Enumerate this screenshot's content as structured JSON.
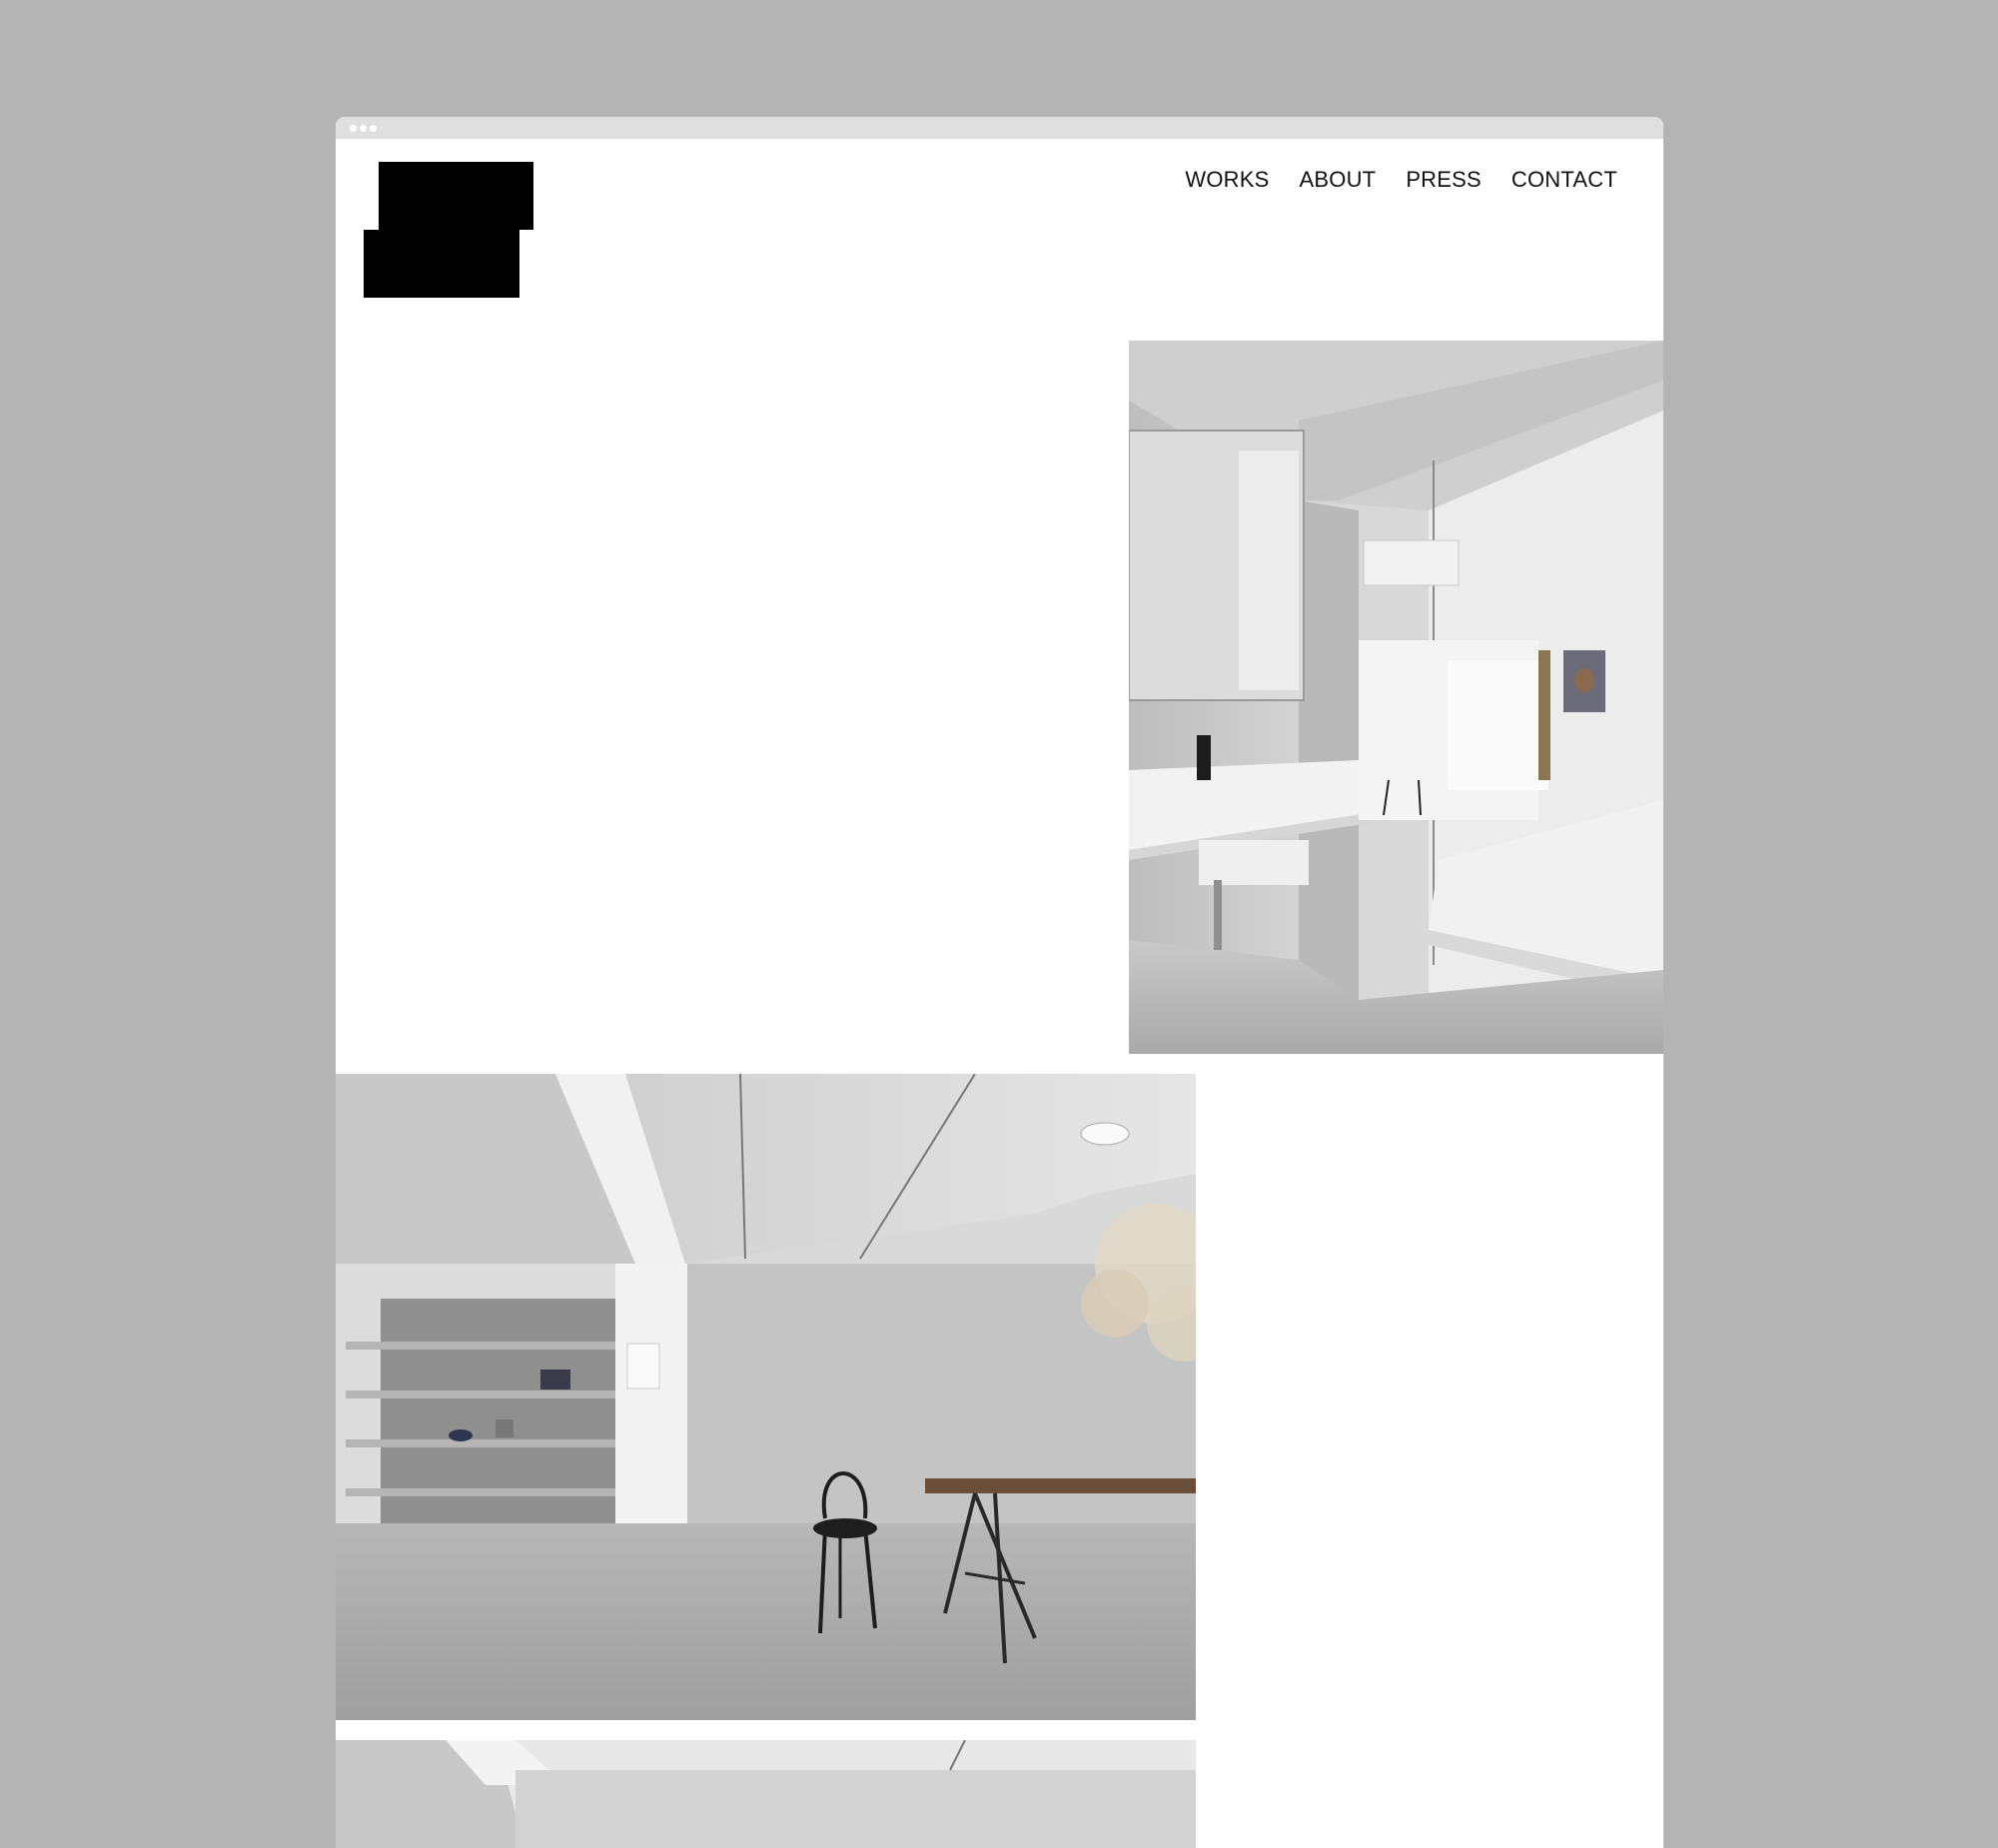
{
  "nav": {
    "items": [
      {
        "label": "WORKS"
      },
      {
        "label": "ABOUT"
      },
      {
        "label": "PRESS"
      },
      {
        "label": "CONTACT"
      }
    ]
  },
  "colors": {
    "backdrop": "#b4b4b4",
    "page": "#ffffff",
    "chrome": "#dfdfdf",
    "logo": "#000000",
    "text": "#111111"
  },
  "gallery": [
    {
      "subject": "bathroom-bedroom-interior"
    },
    {
      "subject": "dining-room-interior"
    },
    {
      "subject": "interior-partial"
    }
  ]
}
